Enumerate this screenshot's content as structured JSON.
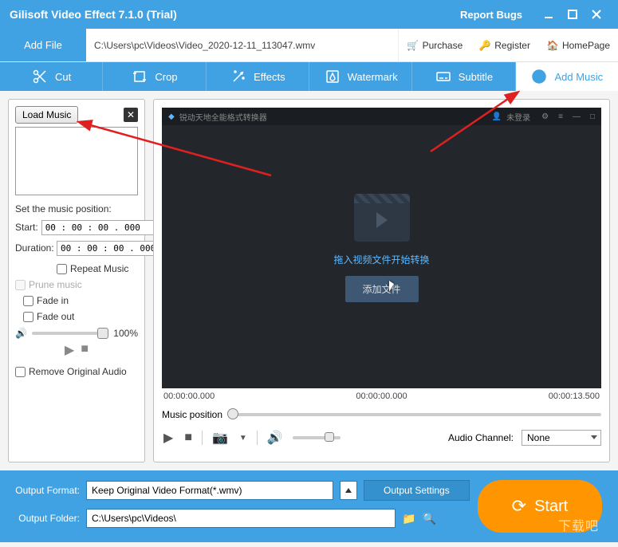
{
  "window": {
    "title": "Gilisoft Video Effect 7.1.0 (Trial)",
    "report_bugs": "Report Bugs"
  },
  "toolbar": {
    "add_file": "Add File",
    "file_path": "C:\\Users\\pc\\Videos\\Video_2020-12-11_113047.wmv",
    "purchase": "Purchase",
    "register": "Register",
    "homepage": "HomePage"
  },
  "tabs": {
    "cut": "Cut",
    "crop": "Crop",
    "effects": "Effects",
    "watermark": "Watermark",
    "subtitle": "Subtitle",
    "add_music": "Add Music"
  },
  "side": {
    "load_music": "Load Music",
    "set_pos": "Set the music position:",
    "start_label": "Start:",
    "start_value": "00 : 00 : 00 . 000",
    "duration_label": "Duration:",
    "duration_value": "00 : 00 : 00 . 000",
    "repeat": "Repeat Music",
    "prune": "Prune music",
    "fade_in": "Fade in",
    "fade_out": "Fade out",
    "vol_pct": "100%",
    "remove_orig": "Remove Original Audio"
  },
  "preview": {
    "inner_title": "锐动天地全能格式转换器",
    "user": "未登录",
    "drag_text": "拖入视频文件开始转换",
    "add_inner": "添加文件",
    "tc_left": "00:00:00.000",
    "tc_mid": "00:00:00.000",
    "tc_right": "00:00:13.500",
    "music_pos": "Music position",
    "audio_channel_label": "Audio Channel:",
    "audio_channel_value": "None"
  },
  "bottom": {
    "out_format_label": "Output Format:",
    "out_format_value": "Keep Original Video Format(*.wmv)",
    "output_settings": "Output Settings",
    "out_folder_label": "Output Folder:",
    "out_folder_value": "C:\\Users\\pc\\Videos\\",
    "start": "Start"
  },
  "watermark_text": "下载吧"
}
